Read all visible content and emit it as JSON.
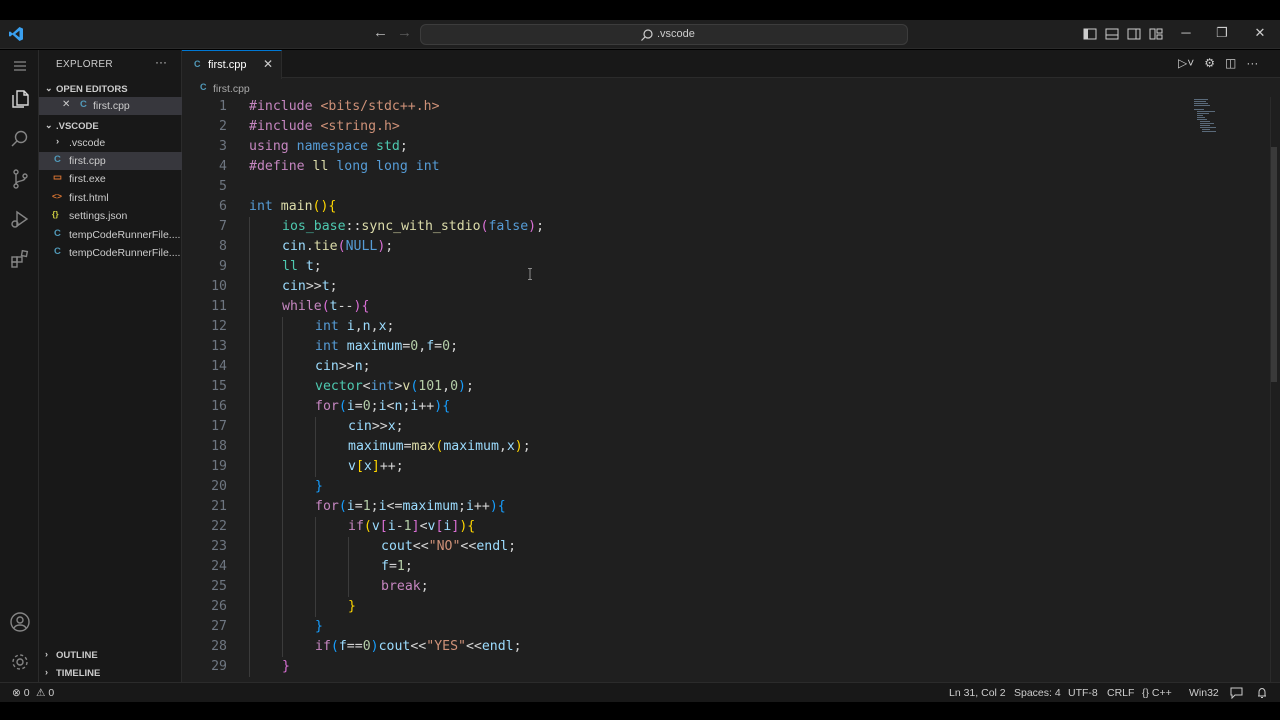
{
  "titlebar": {
    "search_text": ".vscode",
    "back_label": "←",
    "forward_label": "→",
    "minimize_label": "─",
    "restore_label": "❐",
    "close_label": "✕"
  },
  "sidebar": {
    "title": "EXPLORER",
    "more_label": "···",
    "open_editors_label": "OPEN EDITORS",
    "open_editors": [
      {
        "label": "first.cpp",
        "close": "✕"
      }
    ],
    "folder_label": ".VSCODE",
    "files": [
      {
        "label": ".vscode",
        "icon": "›",
        "icon_color": "#cccccc"
      },
      {
        "label": "first.cpp",
        "icon": "C",
        "icon_color": "#519aba"
      },
      {
        "label": "first.exe",
        "icon": "▭",
        "icon_color": "#e37933"
      },
      {
        "label": "first.html",
        "icon": "<>",
        "icon_color": "#e37933"
      },
      {
        "label": "settings.json",
        "icon": "{}",
        "icon_color": "#cbcb41"
      },
      {
        "label": "tempCodeRunnerFile....",
        "icon": "C",
        "icon_color": "#519aba"
      },
      {
        "label": "tempCodeRunnerFile....",
        "icon": "C",
        "icon_color": "#519aba"
      }
    ],
    "outline_label": "OUTLINE",
    "timeline_label": "TIMELINE"
  },
  "editor": {
    "tab_label": "first.cpp",
    "tab_close": "✕",
    "breadcrumb": "first.cpp",
    "actions": [
      "▷˅",
      "⚙",
      "◫",
      "···"
    ]
  },
  "code_lines": [
    {
      "n": "1",
      "indent": 0,
      "tokens": [
        [
          "pre",
          "#include "
        ],
        [
          "st",
          "<bits/stdc++.h>"
        ]
      ]
    },
    {
      "n": "2",
      "indent": 0,
      "tokens": [
        [
          "pre",
          "#include "
        ],
        [
          "st",
          "<string.h>"
        ]
      ]
    },
    {
      "n": "3",
      "indent": 0,
      "tokens": [
        [
          "pre",
          "using "
        ],
        [
          "kw",
          "namespace "
        ],
        [
          "ty",
          "std"
        ],
        [
          "tx",
          ";"
        ]
      ]
    },
    {
      "n": "4",
      "indent": 0,
      "tokens": [
        [
          "pre",
          "#define "
        ],
        [
          "fn",
          "ll "
        ],
        [
          "kw",
          "long long int"
        ]
      ]
    },
    {
      "n": "5",
      "indent": 0,
      "tokens": []
    },
    {
      "n": "6",
      "indent": 0,
      "tokens": [
        [
          "kw",
          "int "
        ],
        [
          "fn",
          "main"
        ],
        [
          "p1",
          "()"
        ],
        [
          "p1",
          "{"
        ]
      ]
    },
    {
      "n": "7",
      "indent": 1,
      "tokens": [
        [
          "ty",
          "ios_base"
        ],
        [
          "tx",
          "::"
        ],
        [
          "fn",
          "sync_with_stdio"
        ],
        [
          "p2",
          "("
        ],
        [
          "kw",
          "false"
        ],
        [
          "p2",
          ")"
        ],
        [
          "tx",
          ";"
        ]
      ]
    },
    {
      "n": "8",
      "indent": 1,
      "tokens": [
        [
          "vr",
          "cin"
        ],
        [
          "tx",
          "."
        ],
        [
          "fn",
          "tie"
        ],
        [
          "p2",
          "("
        ],
        [
          "kw",
          "NULL"
        ],
        [
          "p2",
          ")"
        ],
        [
          "tx",
          ";"
        ]
      ]
    },
    {
      "n": "9",
      "indent": 1,
      "tokens": [
        [
          "ty",
          "ll "
        ],
        [
          "vr",
          "t"
        ],
        [
          "tx",
          ";"
        ]
      ]
    },
    {
      "n": "10",
      "indent": 1,
      "tokens": [
        [
          "vr",
          "cin"
        ],
        [
          "tx",
          ">>"
        ],
        [
          "vr",
          "t"
        ],
        [
          "tx",
          ";"
        ]
      ]
    },
    {
      "n": "11",
      "indent": 1,
      "tokens": [
        [
          "ct",
          "while"
        ],
        [
          "p2",
          "("
        ],
        [
          "vr",
          "t"
        ],
        [
          "tx",
          "--"
        ],
        [
          "p2",
          ")"
        ],
        [
          "p2",
          "{"
        ]
      ]
    },
    {
      "n": "12",
      "indent": 2,
      "tokens": [
        [
          "kw",
          "int "
        ],
        [
          "vr",
          "i"
        ],
        [
          "tx",
          ","
        ],
        [
          "vr",
          "n"
        ],
        [
          "tx",
          ","
        ],
        [
          "vr",
          "x"
        ],
        [
          "tx",
          ";"
        ]
      ]
    },
    {
      "n": "13",
      "indent": 2,
      "tokens": [
        [
          "kw",
          "int "
        ],
        [
          "vr",
          "maximum"
        ],
        [
          "tx",
          "="
        ],
        [
          "nm",
          "0"
        ],
        [
          "tx",
          ","
        ],
        [
          "vr",
          "f"
        ],
        [
          "tx",
          "="
        ],
        [
          "nm",
          "0"
        ],
        [
          "tx",
          ";"
        ]
      ]
    },
    {
      "n": "14",
      "indent": 2,
      "tokens": [
        [
          "vr",
          "cin"
        ],
        [
          "tx",
          ">>"
        ],
        [
          "vr",
          "n"
        ],
        [
          "tx",
          ";"
        ]
      ]
    },
    {
      "n": "15",
      "indent": 2,
      "tokens": [
        [
          "ty",
          "vector"
        ],
        [
          "tx",
          "<"
        ],
        [
          "kw",
          "int"
        ],
        [
          "tx",
          ">"
        ],
        [
          "fn",
          "v"
        ],
        [
          "p3",
          "("
        ],
        [
          "nm",
          "101"
        ],
        [
          "tx",
          ","
        ],
        [
          "nm",
          "0"
        ],
        [
          "p3",
          ")"
        ],
        [
          "tx",
          ";"
        ]
      ]
    },
    {
      "n": "16",
      "indent": 2,
      "tokens": [
        [
          "ct",
          "for"
        ],
        [
          "p3",
          "("
        ],
        [
          "vr",
          "i"
        ],
        [
          "tx",
          "="
        ],
        [
          "nm",
          "0"
        ],
        [
          "tx",
          ";"
        ],
        [
          "vr",
          "i"
        ],
        [
          "tx",
          "<"
        ],
        [
          "vr",
          "n"
        ],
        [
          "tx",
          ";"
        ],
        [
          "vr",
          "i"
        ],
        [
          "tx",
          "++"
        ],
        [
          "p3",
          ")"
        ],
        [
          "p3",
          "{"
        ]
      ]
    },
    {
      "n": "17",
      "indent": 3,
      "tokens": [
        [
          "vr",
          "cin"
        ],
        [
          "tx",
          ">>"
        ],
        [
          "vr",
          "x"
        ],
        [
          "tx",
          ";"
        ]
      ]
    },
    {
      "n": "18",
      "indent": 3,
      "tokens": [
        [
          "vr",
          "maximum"
        ],
        [
          "tx",
          "="
        ],
        [
          "fn",
          "max"
        ],
        [
          "p1",
          "("
        ],
        [
          "vr",
          "maximum"
        ],
        [
          "tx",
          ","
        ],
        [
          "vr",
          "x"
        ],
        [
          "p1",
          ")"
        ],
        [
          "tx",
          ";"
        ]
      ]
    },
    {
      "n": "19",
      "indent": 3,
      "tokens": [
        [
          "vr",
          "v"
        ],
        [
          "p1",
          "["
        ],
        [
          "vr",
          "x"
        ],
        [
          "p1",
          "]"
        ],
        [
          "tx",
          "++;"
        ]
      ]
    },
    {
      "n": "20",
      "indent": 2,
      "tokens": [
        [
          "p3",
          "}"
        ]
      ]
    },
    {
      "n": "21",
      "indent": 2,
      "tokens": [
        [
          "ct",
          "for"
        ],
        [
          "p3",
          "("
        ],
        [
          "vr",
          "i"
        ],
        [
          "tx",
          "="
        ],
        [
          "nm",
          "1"
        ],
        [
          "tx",
          ";"
        ],
        [
          "vr",
          "i"
        ],
        [
          "tx",
          "<="
        ],
        [
          "vr",
          "maximum"
        ],
        [
          "tx",
          ";"
        ],
        [
          "vr",
          "i"
        ],
        [
          "tx",
          "++"
        ],
        [
          "p3",
          ")"
        ],
        [
          "p3",
          "{"
        ]
      ]
    },
    {
      "n": "22",
      "indent": 3,
      "tokens": [
        [
          "ct",
          "if"
        ],
        [
          "p1",
          "("
        ],
        [
          "vr",
          "v"
        ],
        [
          "p2",
          "["
        ],
        [
          "vr",
          "i"
        ],
        [
          "tx",
          "-"
        ],
        [
          "nm",
          "1"
        ],
        [
          "p2",
          "]"
        ],
        [
          "tx",
          "<"
        ],
        [
          "vr",
          "v"
        ],
        [
          "p2",
          "["
        ],
        [
          "vr",
          "i"
        ],
        [
          "p2",
          "]"
        ],
        [
          "p1",
          ")"
        ],
        [
          "p1",
          "{"
        ]
      ]
    },
    {
      "n": "23",
      "indent": 4,
      "tokens": [
        [
          "vr",
          "cout"
        ],
        [
          "tx",
          "<<"
        ],
        [
          "st",
          "\"NO\""
        ],
        [
          "tx",
          "<<"
        ],
        [
          "vr",
          "endl"
        ],
        [
          "tx",
          ";"
        ]
      ]
    },
    {
      "n": "24",
      "indent": 4,
      "tokens": [
        [
          "vr",
          "f"
        ],
        [
          "tx",
          "="
        ],
        [
          "nm",
          "1"
        ],
        [
          "tx",
          ";"
        ]
      ]
    },
    {
      "n": "25",
      "indent": 4,
      "tokens": [
        [
          "ct",
          "break"
        ],
        [
          "tx",
          ";"
        ]
      ]
    },
    {
      "n": "26",
      "indent": 3,
      "tokens": [
        [
          "p1",
          "}"
        ]
      ]
    },
    {
      "n": "27",
      "indent": 2,
      "tokens": [
        [
          "p3",
          "}"
        ]
      ]
    },
    {
      "n": "28",
      "indent": 2,
      "tokens": [
        [
          "ct",
          "if"
        ],
        [
          "p3",
          "("
        ],
        [
          "vr",
          "f"
        ],
        [
          "tx",
          "=="
        ],
        [
          "nm",
          "0"
        ],
        [
          "p3",
          ")"
        ],
        [
          "vr",
          "cout"
        ],
        [
          "tx",
          "<<"
        ],
        [
          "st",
          "\"YES\""
        ],
        [
          "tx",
          "<<"
        ],
        [
          "vr",
          "endl"
        ],
        [
          "tx",
          ";"
        ]
      ]
    },
    {
      "n": "29",
      "indent": 1,
      "tokens": [
        [
          "p2",
          "}"
        ]
      ]
    }
  ],
  "statusbar": {
    "errors": "⊗ 0",
    "warnings": "⚠ 0",
    "position": "Ln 31, Col 2",
    "spaces": "Spaces: 4",
    "encoding": "UTF-8",
    "eol": "CRLF",
    "language": "{} C++",
    "platform": "Win32",
    "accent": "#0078d4"
  }
}
